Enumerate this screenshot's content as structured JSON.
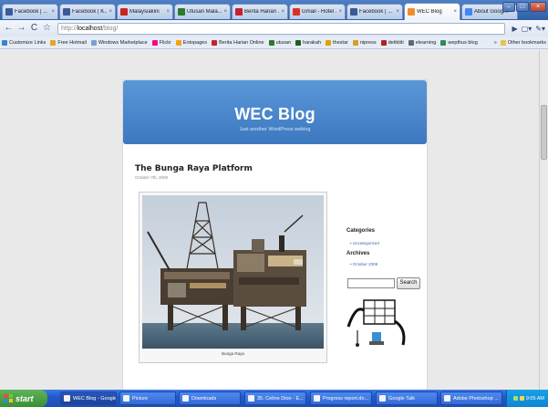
{
  "browser": {
    "tabs": [
      {
        "label": "Facebook | ...",
        "favicon_color": "#3b5998",
        "favicon": "facebook-icon",
        "active": false
      },
      {
        "label": "Facebook | K...",
        "favicon_color": "#3b5998",
        "favicon": "facebook-icon",
        "active": false
      },
      {
        "label": "Malaysiakini",
        "favicon_color": "#cc2222",
        "favicon": "news-icon",
        "active": false
      },
      {
        "label": "Utusan Mala...",
        "favicon_color": "#2a7a2a",
        "favicon": "news-icon",
        "active": false
      },
      {
        "label": "Berita Harian ...",
        "favicon_color": "#c8202f",
        "favicon": "news-icon",
        "active": false
      },
      {
        "label": "Gmail - Hotel ...",
        "favicon_color": "#d93025",
        "favicon": "gmail-icon",
        "active": false
      },
      {
        "label": "Facebook | ...",
        "favicon_color": "#3b5998",
        "favicon": "facebook-icon",
        "active": false
      },
      {
        "label": "WEC Blog",
        "favicon_color": "#f28c28",
        "favicon": "page-icon",
        "active": true
      },
      {
        "label": "About Googl...",
        "favicon_color": "#4285f4",
        "favicon": "google-icon",
        "active": false
      }
    ],
    "address": {
      "protocol": "http://",
      "host": "localhost",
      "path": "/blog/"
    },
    "bookmarks": [
      {
        "label": "Customize Links",
        "color": "#3b82d6"
      },
      {
        "label": "Free Hotmail",
        "color": "#e6a51e"
      },
      {
        "label": "Windows Marketplace",
        "color": "#7aa0d0"
      },
      {
        "label": "Flickr",
        "color": "#ff0084"
      },
      {
        "label": "Entopages",
        "color": "#f4a31c"
      },
      {
        "label": "Berita Harian Online",
        "color": "#c8202f"
      },
      {
        "label": "utusan",
        "color": "#2a7a2a"
      },
      {
        "label": "harakah",
        "color": "#1f5e1f"
      },
      {
        "label": "thestar",
        "color": "#e0a100"
      },
      {
        "label": "nipress",
        "color": "#d8a020"
      },
      {
        "label": "detiktiti",
        "color": "#b02020"
      },
      {
        "label": "elearning",
        "color": "#666666"
      },
      {
        "label": "wepthus blog",
        "color": "#2e8b57"
      }
    ],
    "other_bookmarks": "Other bookmarks"
  },
  "blog": {
    "title": "WEC Blog",
    "description": "Just another WordPress weblog",
    "post": {
      "title": "The Bunga Raya Platform",
      "date": "October 7th, 2009",
      "caption": "Bunga Raya"
    },
    "sidebar": {
      "categories_heading": "Categories",
      "categories": [
        "Uncategorized"
      ],
      "archives_heading": "Archives",
      "archives": [
        "October 2009"
      ],
      "search_button": "Search"
    }
  },
  "taskbar": {
    "start_label": "start",
    "tasks": [
      {
        "label": "WEC Blog - Google ...",
        "active": true
      },
      {
        "label": "Picture",
        "active": false
      },
      {
        "label": "Downloads",
        "active": false
      },
      {
        "label": "35. Celine Dion - E...",
        "active": false
      },
      {
        "label": "Progress report.do...",
        "active": false
      },
      {
        "label": "Google Talk",
        "active": false
      },
      {
        "label": "Adobe Photoshop ...",
        "active": false
      }
    ],
    "clock": "9:05 AM"
  }
}
